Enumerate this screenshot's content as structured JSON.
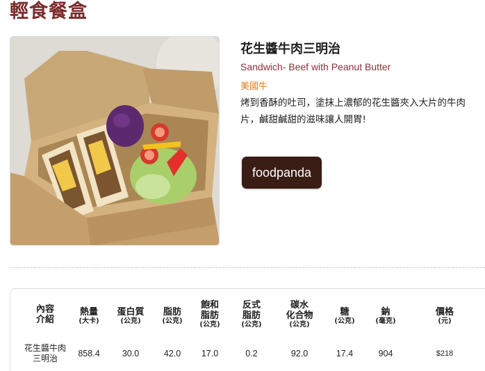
{
  "section": {
    "title": "輕食餐盒"
  },
  "product": {
    "name": "花生醬牛肉三明治",
    "name_en": "Sandwich- Beef with Peanut Butter",
    "tag": "美國牛",
    "description": "烤到香酥的吐司，塗抹上濃郁的花生醬夾入大片的牛肉片，鹹甜鹹甜的滋味讓人開胃!",
    "order_button": "foodpanda",
    "brand_color": "#3a1d15"
  },
  "nutrition": {
    "headers": [
      {
        "line1": "內容",
        "line2": "介紹",
        "unit": ""
      },
      {
        "line1": "熱量",
        "line2": "",
        "unit": "(大卡)"
      },
      {
        "line1": "蛋白質",
        "line2": "",
        "unit": "(公克)"
      },
      {
        "line1": "脂肪",
        "line2": "",
        "unit": "(公克)"
      },
      {
        "line1": "飽和",
        "line2": "脂肪",
        "unit": "(公克)"
      },
      {
        "line1": "反式",
        "line2": "脂肪",
        "unit": "(公克)"
      },
      {
        "line1": "碳水",
        "line2": "化合物",
        "unit": "(公克)"
      },
      {
        "line1": "糖",
        "line2": "",
        "unit": "(公克)"
      },
      {
        "line1": "鈉",
        "line2": "",
        "unit": "(毫克)"
      },
      {
        "line1": "價格",
        "line2": "",
        "unit": "(元)"
      }
    ],
    "row": {
      "name_line1": "花生醬牛肉",
      "name_line2": "三明治",
      "calories": "858.4",
      "protein": "30.0",
      "fat": "42.0",
      "saturated_fat": "17.0",
      "trans_fat": "0.2",
      "carbohydrate": "92.0",
      "sugar": "17.4",
      "sodium": "904",
      "price": "$218"
    }
  }
}
